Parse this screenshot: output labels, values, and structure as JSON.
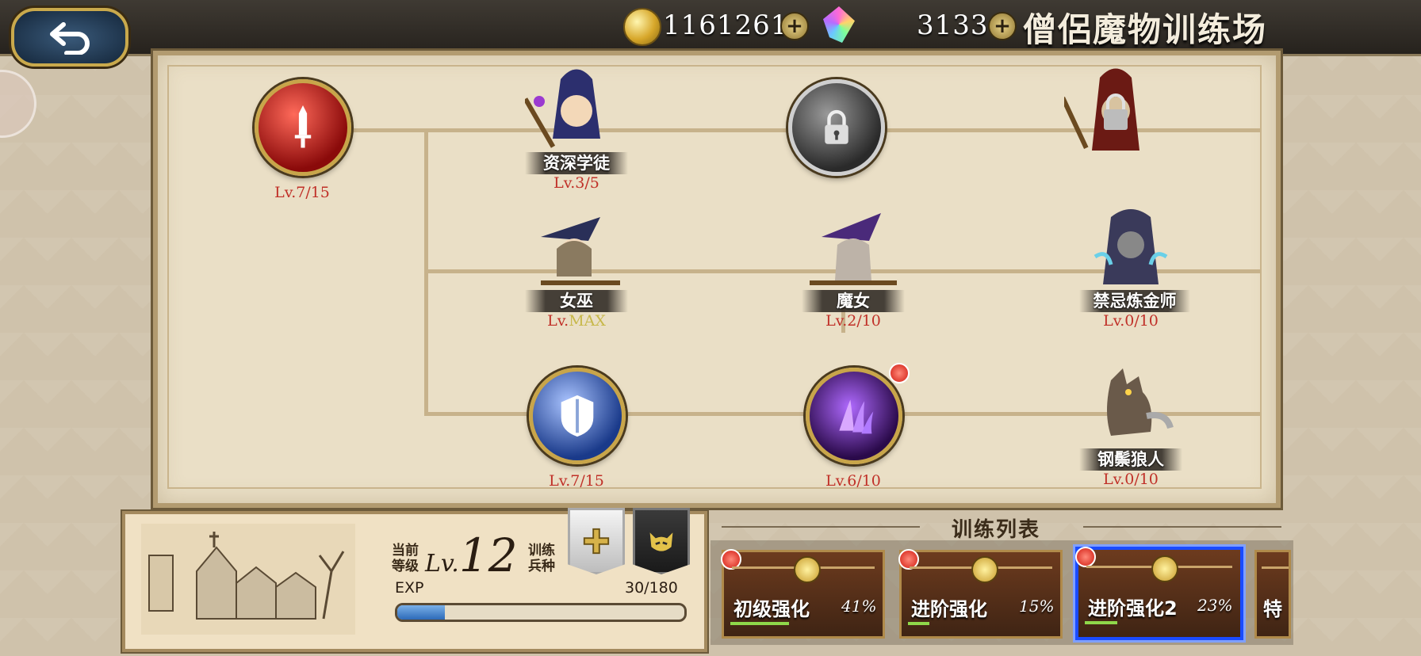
{
  "header": {
    "back_icon": "return-arrow-icon",
    "gold_amount": "11612611",
    "gem_amount": "3133",
    "title": "僧侶魔物训练场"
  },
  "skill_tree": {
    "nodes": [
      {
        "kind": "icon",
        "icon": "sword-icon",
        "level": "Lv.7/15"
      },
      {
        "kind": "character",
        "name": "资深学徒",
        "level": "Lv.3/5"
      },
      {
        "kind": "icon",
        "icon": "locked-icon",
        "level": ""
      },
      {
        "kind": "character",
        "name": "",
        "level": "",
        "locked": true
      },
      {
        "kind": "character",
        "name": "女巫",
        "level_prefix": "Lv.",
        "level_max": "MAX"
      },
      {
        "kind": "character",
        "name": "魔女",
        "level": "Lv.2/10"
      },
      {
        "kind": "character",
        "name": "禁忌炼金师",
        "level": "Lv.0/10"
      },
      {
        "kind": "icon",
        "icon": "shield-icon",
        "level": "Lv.7/15"
      },
      {
        "kind": "icon",
        "icon": "dark-claw-icon",
        "level": "Lv.6/10",
        "notification": true
      },
      {
        "kind": "character",
        "name": "钢鬃狼人",
        "level": "Lv.0/10"
      }
    ]
  },
  "info": {
    "current_label_1": "当前",
    "current_label_2": "等级",
    "lv_prefix": "Lv.",
    "lv_value": "12",
    "train_label_1": "训练",
    "train_label_2": "兵种",
    "exp_label": "EXP",
    "exp_value": "30/180",
    "exp_fraction": 0.167
  },
  "training_list": {
    "title": "训练列表",
    "cards": [
      {
        "name": "初级强化",
        "pct": "41%",
        "progress": 0.41,
        "selected": false
      },
      {
        "name": "进阶强化",
        "pct": "15%",
        "progress": 0.15,
        "selected": false
      },
      {
        "name": "进阶强化2",
        "pct": "23%",
        "progress": 0.23,
        "selected": true
      },
      {
        "name": "特",
        "pct": "",
        "progress": 0,
        "selected": false
      }
    ]
  }
}
